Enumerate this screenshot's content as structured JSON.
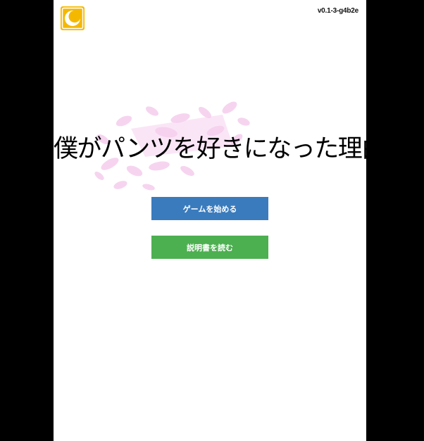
{
  "version": "v0.1-3-g4b2e",
  "logo_icon": "crescent-moon-logo-icon",
  "title": "僕がパンツを好きになった理由",
  "title_art_icon": "pink-petals-background-icon",
  "menu": {
    "start_label": "ゲームを始める",
    "manual_label": "説明書を読む"
  },
  "colors": {
    "page_background": "#000000",
    "stage_background": "#ffffff",
    "start_button": "#3a7bbd",
    "manual_button": "#4caf50",
    "logo": "#f5b800",
    "petals": "#f3c6ea"
  }
}
